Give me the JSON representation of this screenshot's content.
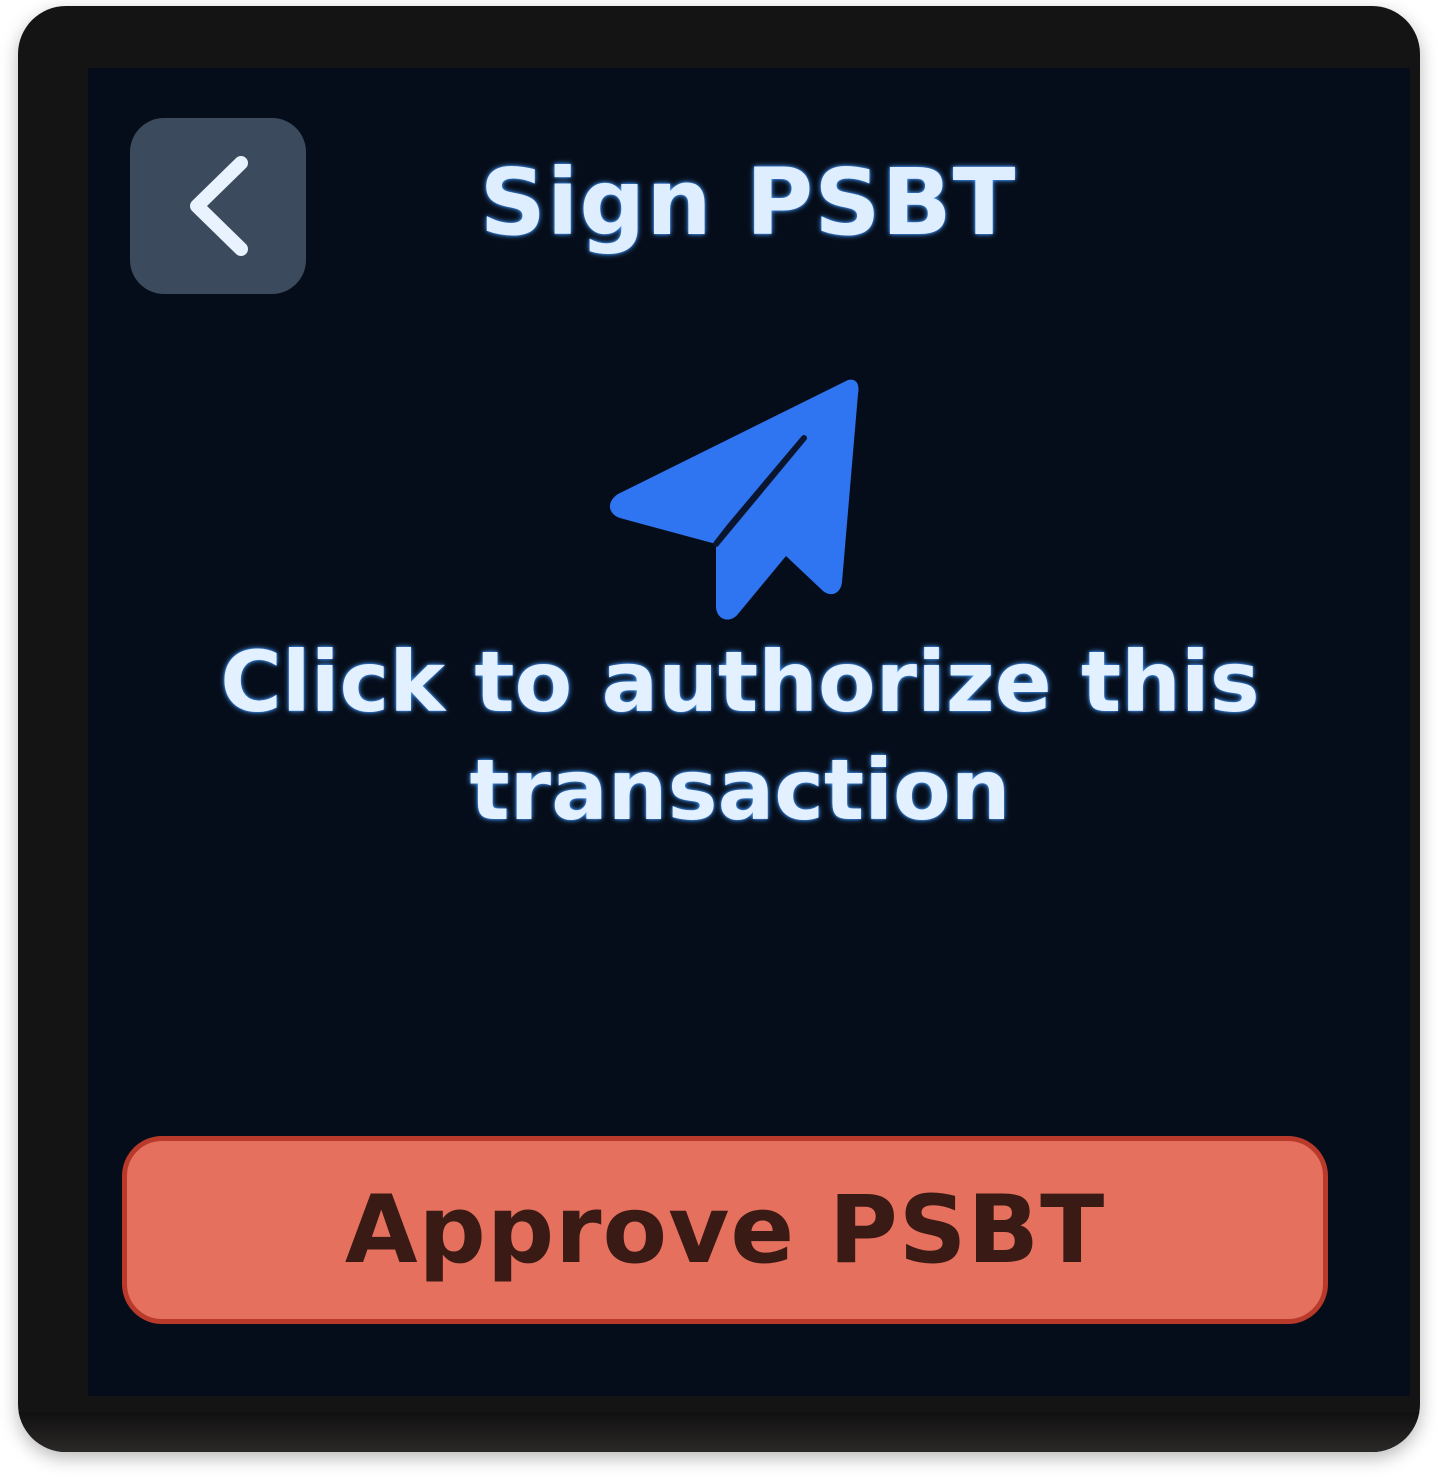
{
  "header": {
    "title": "Sign PSBT",
    "back_icon": "chevron-left-icon"
  },
  "main": {
    "icon": "send-icon",
    "message": "Click to authorize this transaction"
  },
  "footer": {
    "approve_label": "Approve PSBT"
  },
  "colors": {
    "screen_background": "#060d1a",
    "back_button": "#3b4a5c",
    "title_text": "#dfeeff",
    "icon_accent": "#2f74f0",
    "approve_button": "#e5705e",
    "approve_text": "#3a1a14"
  }
}
